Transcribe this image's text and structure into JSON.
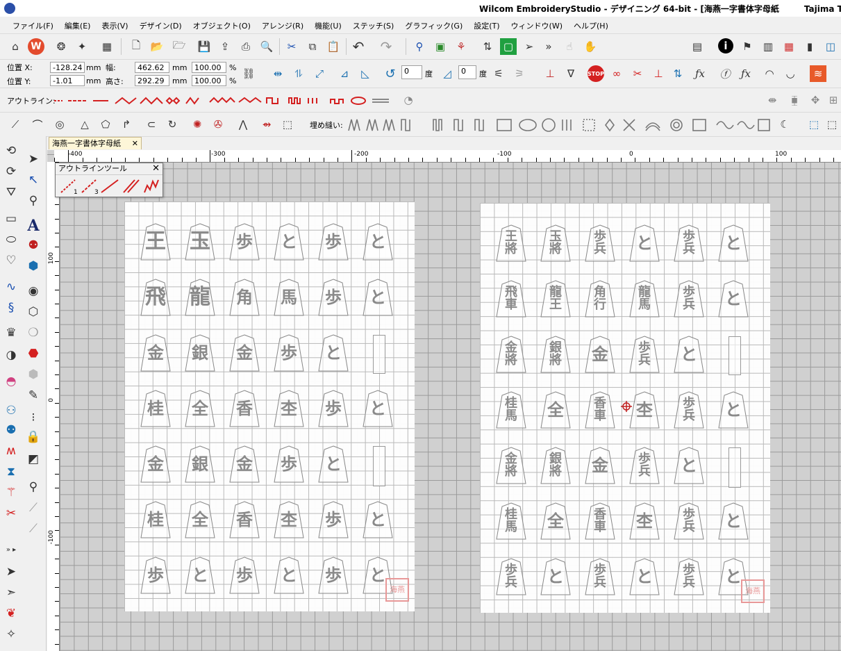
{
  "window": {
    "title": "Wilcom EmbroideryStudio - デザイニング 64-bit - [海燕一字書体字母紙　　　Tajima TBF]"
  },
  "menu": [
    "ファイル(F)",
    "編集(E)",
    "表示(V)",
    "デザイン(D)",
    "オブジェクト(O)",
    "アレンジ(R)",
    "機能(U)",
    "ステッチ(S)",
    "グラフィック(G)",
    "設定(T)",
    "ウィンドウ(W)",
    "ヘルプ(H)"
  ],
  "toolbar": {
    "zoom_value": "100",
    "zoom_unit": "%"
  },
  "properties": {
    "pos_x_label": "位置 X:",
    "pos_x": "-128.24",
    "pos_y_label": "位置 Y:",
    "pos_y": "-1.01",
    "width_label": "幅:",
    "width": "462.62",
    "height_label": "高さ:",
    "height": "292.29",
    "unit": "mm",
    "scale_w": "100.00",
    "scale_h": "100.00",
    "pct": "%",
    "rotate_value": "0",
    "rotate_unit": "度",
    "skew_value": "0",
    "skew_unit": "度"
  },
  "outline_bar": {
    "label": "アウトライン:"
  },
  "fill_bar": {
    "label": "埋め縫い:"
  },
  "document_tab": {
    "label": "海燕一字書体字母紙",
    "close": "✕"
  },
  "outline_tools_panel": {
    "title": "アウトラインツール",
    "close": "✕",
    "tool1_num": "1",
    "tool2_num": "3"
  },
  "ruler": {
    "top_labels": [
      "-400",
      "-300",
      "-200",
      "-100",
      "0",
      "100"
    ],
    "left_labels": [
      "100",
      "0",
      "-100"
    ]
  },
  "sheet_left": {
    "rows": [
      [
        "王",
        "玉",
        "歩",
        "と",
        "歩",
        "と"
      ],
      [
        "飛",
        "龍",
        "角",
        "馬",
        "歩",
        "と"
      ],
      [
        "金",
        "銀",
        "金",
        "歩",
        "と",
        ""
      ],
      [
        "桂",
        "全",
        "香",
        "杢",
        "歩",
        "と"
      ],
      [
        "金",
        "銀",
        "金",
        "歩",
        "と",
        ""
      ],
      [
        "桂",
        "全",
        "香",
        "杢",
        "歩",
        "と"
      ],
      [
        "歩",
        "と",
        "歩",
        "と",
        "歩",
        "と"
      ]
    ],
    "stamp": "海燕"
  },
  "sheet_right": {
    "rows": [
      [
        "王將",
        "玉將",
        "歩兵",
        "と",
        "歩兵",
        "と"
      ],
      [
        "飛車",
        "龍王",
        "角行",
        "龍馬",
        "歩兵",
        "と"
      ],
      [
        "金將",
        "銀將",
        "金",
        "歩兵",
        "と",
        ""
      ],
      [
        "桂馬",
        "全",
        "香車",
        "杢",
        "歩兵",
        "と"
      ],
      [
        "金將",
        "銀將",
        "金",
        "歩兵",
        "と",
        ""
      ],
      [
        "桂馬",
        "全",
        "香車",
        "杢",
        "歩兵",
        "と"
      ],
      [
        "歩兵",
        "と",
        "歩兵",
        "と",
        "歩兵",
        "と"
      ]
    ],
    "stamp": "海燕"
  },
  "icons": {
    "top_row": [
      "home-icon",
      "wilcom-logo-icon",
      "balloon-icon",
      "wand-icon",
      "folder-stack-icon",
      "new-doc-icon",
      "open-icon",
      "open-recent-icon",
      "save-icon",
      "export-icon",
      "print-icon",
      "preview-icon",
      "cut-icon",
      "copy-icon",
      "paste-icon",
      "undo-icon",
      "redo-icon",
      "stitch-player-icon",
      "monitor-icon",
      "thread-icon",
      "info-icon"
    ]
  },
  "colors": {
    "sheet_piece_text": "#8a8a8a",
    "stamp": "#e89898",
    "accent_red": "#d42020"
  }
}
